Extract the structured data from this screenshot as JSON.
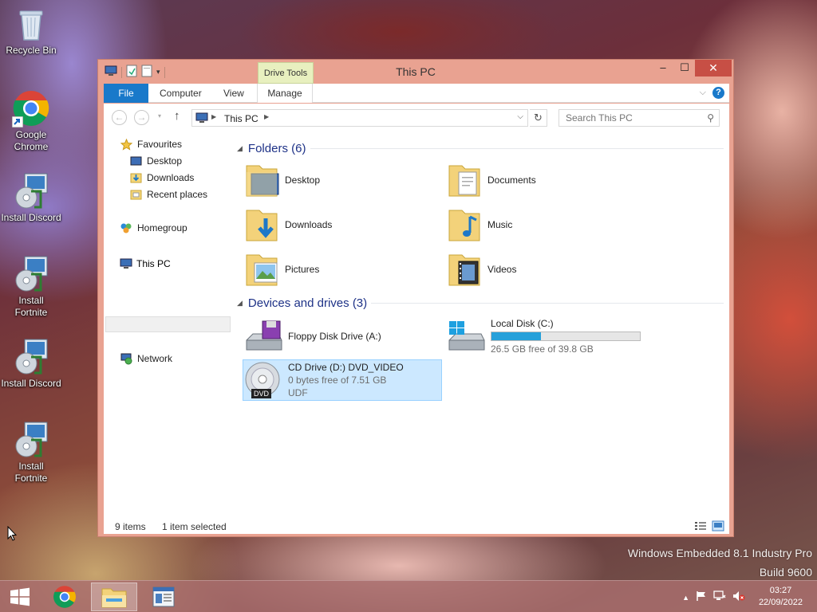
{
  "desktop": {
    "icons": [
      {
        "label": "Recycle Bin"
      },
      {
        "label": "Google Chrome"
      },
      {
        "label": "Install Discord"
      },
      {
        "label": "Install Fortnite"
      },
      {
        "label": "Install Discord"
      },
      {
        "label": "Install Fortnite"
      }
    ],
    "watermark": {
      "line1": "Windows Embedded 8.1 Industry Pro",
      "line2": "Build 9600"
    }
  },
  "window": {
    "title": "This PC",
    "context_tab": "Drive Tools",
    "buttons": {
      "minimize": "–",
      "maximize": "☐",
      "close": "✕"
    },
    "ribbon_tabs": {
      "file": "File",
      "computer": "Computer",
      "view": "View",
      "manage": "Manage"
    },
    "help": "?",
    "address": {
      "crumb": "This PC"
    },
    "search": {
      "placeholder": "Search This PC"
    }
  },
  "navpane": {
    "favourites": "Favourites",
    "desktop": "Desktop",
    "downloads": "Downloads",
    "recent": "Recent places",
    "homegroup": "Homegroup",
    "thispc": "This PC",
    "network": "Network"
  },
  "folders": {
    "header": "Folders (6)",
    "items": [
      {
        "label": "Desktop"
      },
      {
        "label": "Documents"
      },
      {
        "label": "Downloads"
      },
      {
        "label": "Music"
      },
      {
        "label": "Pictures"
      },
      {
        "label": "Videos"
      }
    ]
  },
  "drives": {
    "header": "Devices and drives (3)",
    "floppy": {
      "name": "Floppy Disk Drive (A:)"
    },
    "local": {
      "name": "Local Disk (C:)",
      "free": "26.5 GB free of 39.8 GB",
      "used_fraction": 0.334
    },
    "cd": {
      "name": "CD Drive (D:) DVD_VIDEO",
      "free": "0 bytes free of 7.51 GB",
      "fs": "UDF",
      "badge": "DVD"
    }
  },
  "status": {
    "items": "9 items",
    "selected": "1 item selected"
  },
  "taskbar": {
    "time": "03:27",
    "date": "22/09/2022"
  }
}
